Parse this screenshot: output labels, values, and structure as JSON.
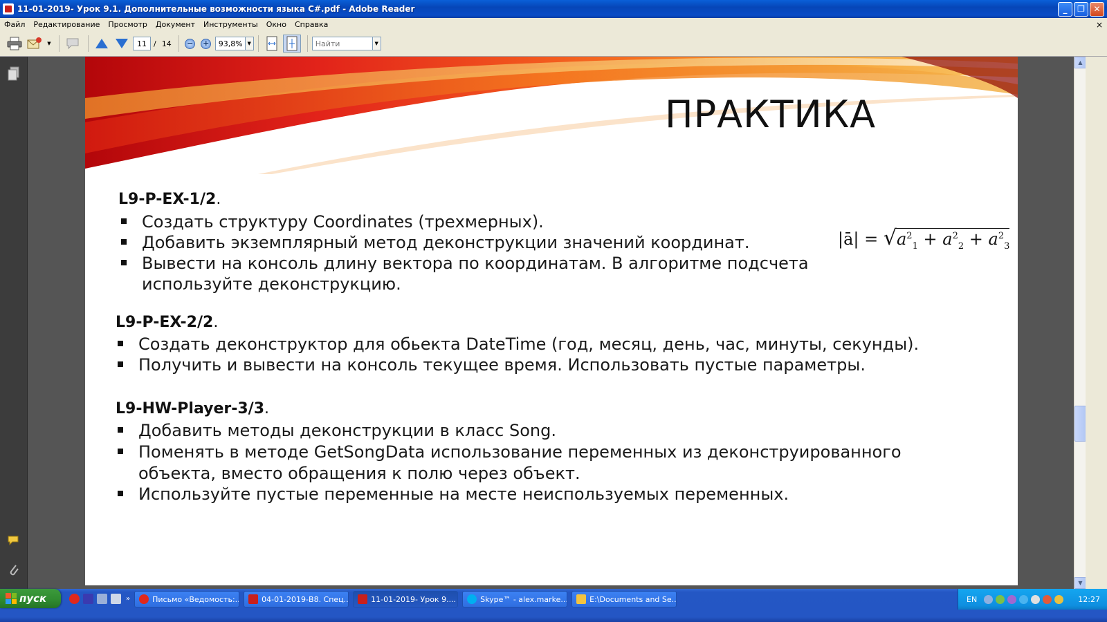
{
  "window": {
    "title": "11-01-2019- Урок 9.1. Дополнительные возможности языка C#.pdf - Adobe Reader",
    "minimize": "_",
    "maximize": "❐",
    "close": "✕"
  },
  "menu": {
    "items": [
      "Файл",
      "Редактирование",
      "Просмотр",
      "Документ",
      "Инструменты",
      "Окно",
      "Справка"
    ],
    "close_symbol": "×"
  },
  "toolbar": {
    "current_page": "11",
    "page_separator": "/",
    "total_pages": "14",
    "zoom": "93,8%",
    "zoom_out": "−",
    "zoom_in": "+",
    "find_placeholder": "Найти"
  },
  "slide": {
    "title": "ПРАКТИКА",
    "sections": [
      {
        "heading": "L9-P-EX-1/2",
        "dot": ".",
        "bullets": [
          [
            "Создать структуру Coordinates (трехмерных)."
          ],
          [
            "Добавить экземплярный метод деконструкции значений координат."
          ],
          [
            "Вывести на консоль длину вектора по координатам. В алгоритме подсчета",
            "используйте деконструкцию."
          ]
        ]
      },
      {
        "heading": "L9-P-EX-2/2",
        "dot": ".",
        "bullets": [
          [
            "Создать деконструктор для обьекта DateTime (год, месяц, день, час, минуты, секунды)."
          ],
          [
            "Получить и вывести на консоль текущее время. Использовать пустые параметры."
          ]
        ]
      },
      {
        "heading": "L9-HW-Player-3/3",
        "dot": ".",
        "bullets": [
          [
            "Добавить методы деконструкции в класс Song."
          ],
          [
            "Поменять в методе GetSongData использование переменных из деконструированного",
            "объекта, вместо обращения к полю через объект."
          ],
          [
            "Используйте пустые переменные на месте неиспользуемых переменных."
          ]
        ]
      }
    ],
    "formula": {
      "lhs": "|ā| =",
      "a": "a",
      "sub1": "1",
      "sub2": "2",
      "sub3": "3",
      "sup": "2",
      "plus": "+"
    }
  },
  "taskbar": {
    "start_label": "пуск",
    "chevron": "»",
    "tasks": [
      {
        "label": "Письмо «Ведомость:...",
        "icon_color": "#e0281c",
        "active": false
      },
      {
        "label": "04-01-2019-В8. Спец...",
        "icon_color": "#c8201c",
        "active": false
      },
      {
        "label": "11-01-2019- Урок 9....",
        "icon_color": "#c8201c",
        "active": true
      },
      {
        "label": "Skype™ - alex.marke...",
        "icon_color": "#00aff0",
        "active": false
      },
      {
        "label": "E:\\Documents and Se...",
        "icon_color": "#f3c340",
        "active": false
      }
    ],
    "lang": "EN",
    "clock": "12:27"
  }
}
